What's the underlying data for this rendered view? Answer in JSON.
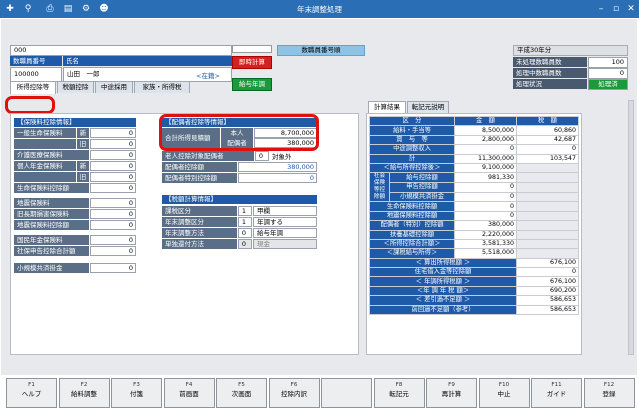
{
  "window": {
    "title": "年末調整処理"
  },
  "toolbar_icons": [
    "new-user-icon",
    "search-icon",
    "print-icon",
    "print-preview-icon",
    "settings-icon",
    "user-icon"
  ],
  "employee": {
    "code_top": "000",
    "num_label": "数職員番号",
    "name_label": "氏名",
    "num_value": "100000",
    "name_value": "山田　一郎",
    "status": "<在籍>",
    "btn_immediate": "即時計算",
    "btn_salary": "給与年調",
    "field_title": "数職員番号順"
  },
  "info": {
    "year": "平成30年分",
    "rows": [
      {
        "label": "未処理数職員数",
        "value": "100"
      },
      {
        "label": "処理中数職員数",
        "value": "0"
      },
      {
        "label": "処理状況",
        "value": "処理済"
      }
    ]
  },
  "tabs": [
    "所得控除等",
    "税額控除",
    "中途採用",
    "家族・所得税"
  ],
  "right_tabs": [
    "計算結果",
    "転記元説明"
  ],
  "insurance": {
    "title": "【保険料控除情報】",
    "rows": [
      {
        "label": "一般生命保険料",
        "mark": "新",
        "value": "0"
      },
      {
        "label": "",
        "mark": "旧",
        "value": "0"
      },
      {
        "label": "介護医療保険料",
        "mark": "",
        "value": "0"
      },
      {
        "label": "個人年金保険料",
        "mark": "新",
        "value": "0"
      },
      {
        "label": "",
        "mark": "旧",
        "value": "0"
      },
      {
        "label": "生命保険料控除額",
        "mark": "",
        "value": "0"
      },
      {
        "label": "地震保険料",
        "mark": "",
        "value": "0"
      },
      {
        "label": "旧長期損害保険料",
        "mark": "",
        "value": "0"
      },
      {
        "label": "地震保険料控除額",
        "mark": "",
        "value": "0"
      },
      {
        "label": "国民年金保険料",
        "mark": "",
        "value": "0"
      },
      {
        "label": "社保申告控除合計額",
        "mark": "",
        "value": "0"
      },
      {
        "label": "小規模共済掛金",
        "mark": "",
        "value": "0"
      }
    ]
  },
  "spouse": {
    "title": "【配偶者控除等情報】",
    "total_label": "合計所得見積額",
    "self_label": "本人",
    "self_value": "8,700,000",
    "spouse_label": "配偶者",
    "spouse_value": "380,000",
    "rows": [
      {
        "label": "老人控除対象配偶者",
        "code": "0",
        "text": "対象外"
      },
      {
        "label": "配偶者控除額",
        "value": "380,000"
      },
      {
        "label": "配偶者特別控除額",
        "value": "0"
      }
    ]
  },
  "tax": {
    "title": "【税額計算情報】",
    "rows": [
      {
        "label": "課税区分",
        "code": "1",
        "text": "甲欄"
      },
      {
        "label": "年末調整区分",
        "code": "1",
        "text": "年調する"
      },
      {
        "label": "年末調整方法",
        "code": "0",
        "text": "給与年調"
      },
      {
        "label": "単独還付方法",
        "code": "0",
        "text": "現金"
      }
    ]
  },
  "result": {
    "headers": [
      "区　分",
      "金　額",
      "税　額"
    ],
    "rows": [
      {
        "label": "給料・手当等",
        "amount": "8,500,000",
        "tax": "60,860"
      },
      {
        "label": "賞　与　等",
        "amount": "2,800,000",
        "tax": "42,687"
      },
      {
        "label": "中途調整収入",
        "amount": "0",
        "tax": "0"
      },
      {
        "label": "計",
        "amount": "11,300,000",
        "tax": "103,547"
      },
      {
        "label": "＜給与所得控除後＞",
        "amount": "9,100,000",
        "tax": ""
      },
      {
        "label": "給与控除額",
        "amount": "981,330",
        "tax": ""
      },
      {
        "label": "申告控除額",
        "amount": "0",
        "tax": ""
      },
      {
        "label": "小規模共済掛金",
        "amount": "0",
        "tax": ""
      },
      {
        "label": "生命保険料控除額",
        "amount": "0",
        "tax": ""
      },
      {
        "label": "地震保険料控除額",
        "amount": "0",
        "tax": ""
      },
      {
        "label": "配偶者（特別）控除額",
        "amount": "380,000",
        "tax": ""
      },
      {
        "label": "扶養基礎控除額",
        "amount": "2,220,000",
        "tax": ""
      },
      {
        "label": "＜所得控除合計額＞",
        "amount": "3,581,330",
        "tax": ""
      },
      {
        "label": "＜課税給与所得＞",
        "amount": "5,518,000",
        "tax": ""
      }
    ],
    "group_label": "社会保険等控除額",
    "lower": [
      {
        "label": "＜ 算出所得税額 ＞",
        "value": "676,100"
      },
      {
        "label": "住宅借入金等控除額",
        "value": "0"
      },
      {
        "label": "＜ 年調所得税額 ＞",
        "value": "676,100"
      },
      {
        "label": "＜年 調 年 税 額＞",
        "value": "690,200"
      },
      {
        "label": "＜ 差引過不足額 ＞",
        "value": "586,653"
      },
      {
        "label": "前回過不足額（参考）",
        "value": "586,653"
      }
    ]
  },
  "fkeys": [
    {
      "key": "F1",
      "label": "ヘルプ"
    },
    {
      "key": "F2",
      "label": "給料調整"
    },
    {
      "key": "F3",
      "label": "付箋"
    },
    {
      "key": "F4",
      "label": "前画面"
    },
    {
      "key": "F5",
      "label": "次画面"
    },
    {
      "key": "F6",
      "label": "控除内訳"
    },
    {
      "key": "",
      "label": ""
    },
    {
      "key": "F8",
      "label": "転記元"
    },
    {
      "key": "F9",
      "label": "再計算"
    },
    {
      "key": "F10",
      "label": "中止"
    },
    {
      "key": "F11",
      "label": "ガイド"
    },
    {
      "key": "F12",
      "label": "登録"
    }
  ]
}
